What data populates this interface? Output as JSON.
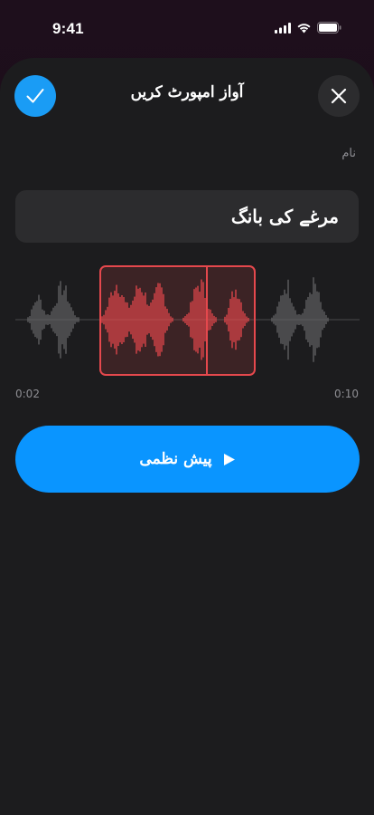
{
  "status_bar": {
    "time": "9:41",
    "icons": [
      "signal-icon",
      "wifi-icon",
      "battery-icon"
    ]
  },
  "header": {
    "title": "آواز امپورٹ کریں",
    "confirm_icon": "checkmark-icon",
    "close_icon": "close-icon"
  },
  "form": {
    "name_label": "نام",
    "name_value": "مرغے کی بانگ"
  },
  "trimmer": {
    "start_time": "0:02",
    "end_time": "0:10",
    "selection_color": "#e5484d",
    "wave_color": "#636366"
  },
  "preview": {
    "label": "پیش نظمی",
    "icon": "play-icon"
  },
  "colors": {
    "accent": "#0a95ff",
    "sheet_background": "#1c1c1e",
    "field_background": "#2c2c2e"
  }
}
